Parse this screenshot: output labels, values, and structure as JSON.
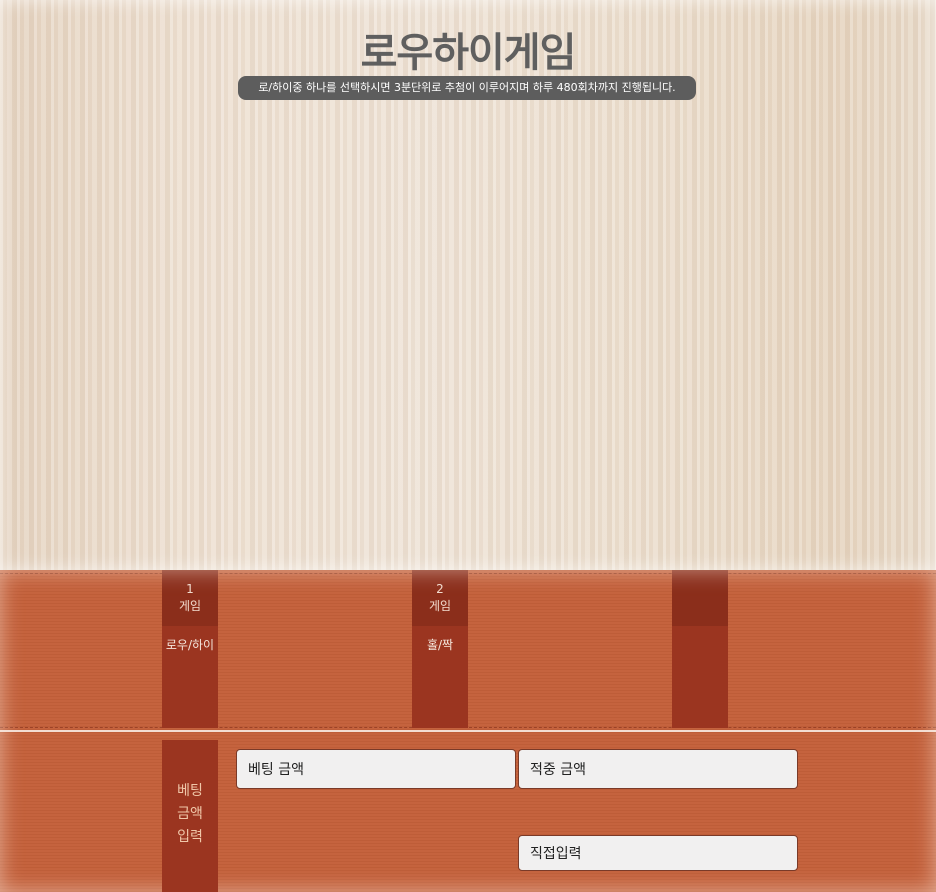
{
  "header": {
    "title": "로우하이게임",
    "notice": "로/하이중 하나를 선택하시면 3분단위로 추첨이 이루어지며 하루 480회차까지 진행됩니다."
  },
  "games": [
    {
      "number": "1",
      "word": "게임",
      "label": "로우/하이"
    },
    {
      "number": "2",
      "word": "게임",
      "label": "홀/짝"
    },
    {
      "number": "",
      "word": "",
      "label": ""
    }
  ],
  "bet": {
    "label_line1": "베팅",
    "label_line2": "금액",
    "label_line3": "입력",
    "bet_amount": "베팅 금액",
    "win_amount": "적중 금액",
    "manual_input": "직접입력"
  },
  "colors": {
    "panel": "#c4603a",
    "column": "#9b3520",
    "column_head": "#8b2e1b",
    "title": "#5f5f5f"
  }
}
